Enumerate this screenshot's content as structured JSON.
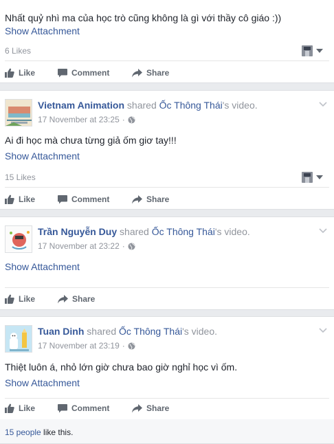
{
  "post1": {
    "text": "Nhất quỷ nhì ma của học trò cũng không là gì với thầy cô giáo :))",
    "attachment": "Show Attachment",
    "likes": "6 Likes"
  },
  "post2": {
    "author": "Vietnam Animation",
    "shared": "shared",
    "page": "Ốc Thông Thái",
    "suffix": "'s video.",
    "time": "17 November at 23:25",
    "dot": "·",
    "text": "Ai đi học mà chưa từng giả ốm giơ tay!!!",
    "attachment": "Show Attachment",
    "likes": "15 Likes"
  },
  "post3": {
    "author": "Trần Nguyễn Duy",
    "shared": "shared",
    "page": "Ốc Thông Thái",
    "suffix": "'s video.",
    "time": "17 November at 23:22",
    "dot": "·",
    "attachment": "Show Attachment"
  },
  "post4": {
    "author": "Tuan Dinh",
    "shared": "shared",
    "page": "Ốc Thông Thái",
    "suffix": "'s video.",
    "time": "17 November at 23:19",
    "dot": "·",
    "text": "Thiệt luôn á, nhỏ lớn giờ chưa bao giờ nghỉ học vì ốm.",
    "attachment": "Show Attachment",
    "likes_people": "15 people",
    "likes_suffix": " like this."
  },
  "actions": {
    "like": "Like",
    "comment": "Comment",
    "share": "Share"
  },
  "colors": {
    "link": "#365899",
    "muted": "#90949c",
    "action": "#606770",
    "background": "#e9ebee"
  },
  "icons": [
    "like-icon",
    "comment-icon",
    "share-icon",
    "globe-icon",
    "chevron-down-icon",
    "caret-down-icon"
  ]
}
